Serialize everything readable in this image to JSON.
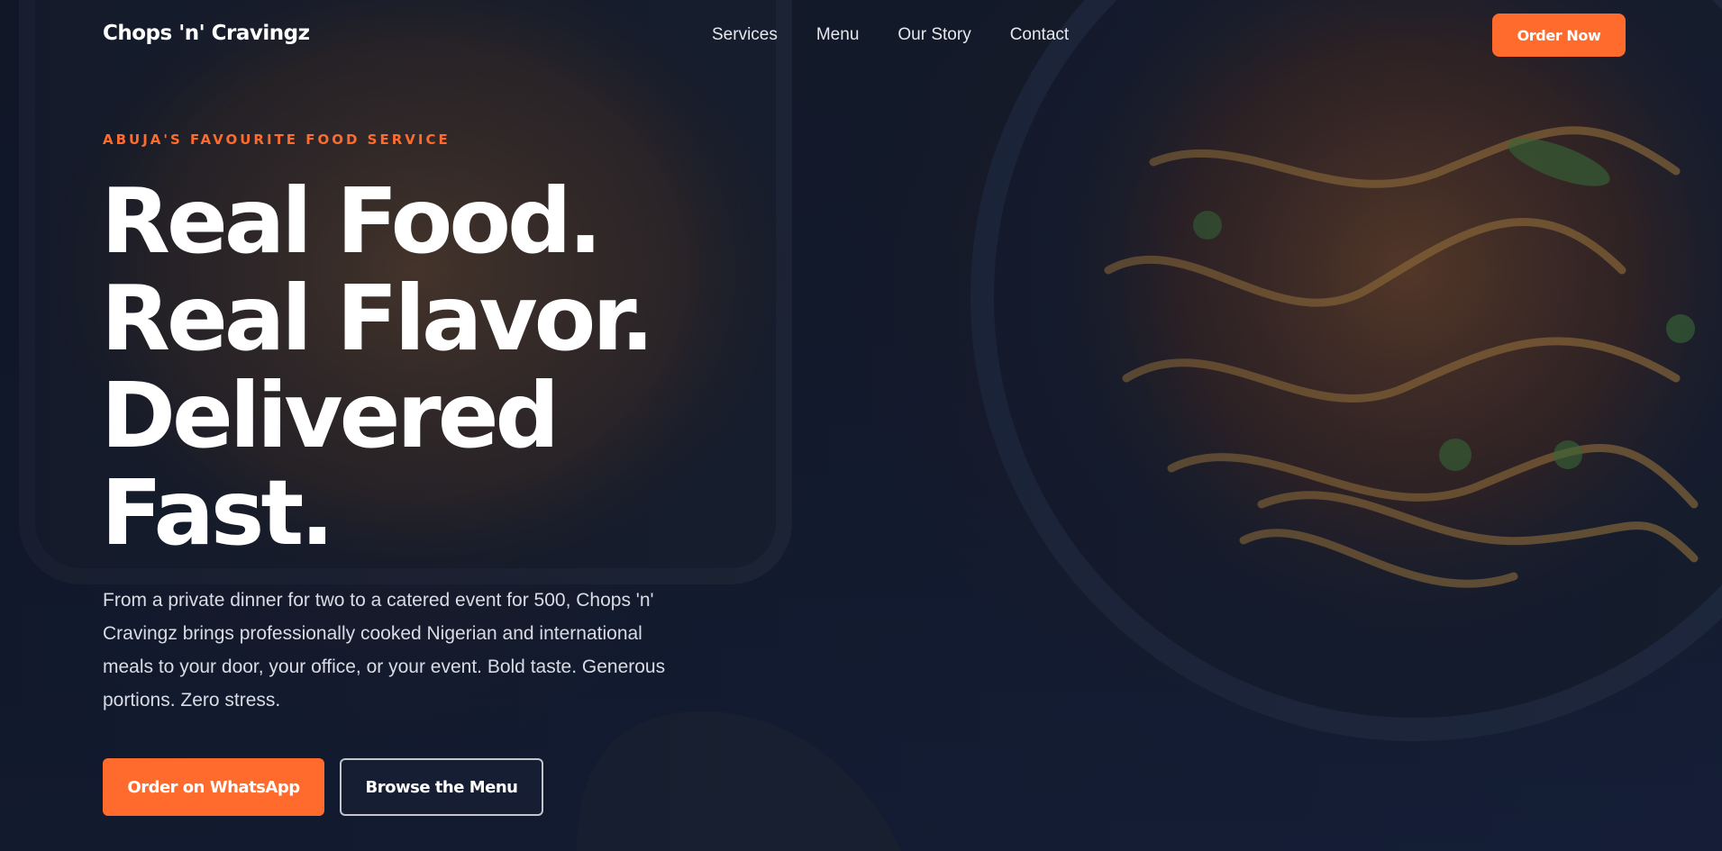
{
  "nav": {
    "brand": "Chops 'n' Cravingz",
    "links": [
      "Services",
      "Menu",
      "Our Story",
      "Contact"
    ],
    "cta_label": "Order Now"
  },
  "hero": {
    "eyebrow": "ABUJA'S FAVOURITE FOOD SERVICE",
    "headline_lines": [
      "Real Food.",
      "Real Flavor.",
      "Delivered",
      "Fast."
    ],
    "description": "From a private dinner for two to a catered event for 500, Chops 'n' Cravingz brings professionally cooked Nigerian and international meals to your door, your office, or your event. Bold taste. Generous portions. Zero stress.",
    "primary_cta": "Order on WhatsApp",
    "secondary_cta": "Browse the Menu"
  },
  "colors": {
    "accent": "#ff6b2c",
    "background": "#131b2e",
    "text": "#ffffff"
  }
}
